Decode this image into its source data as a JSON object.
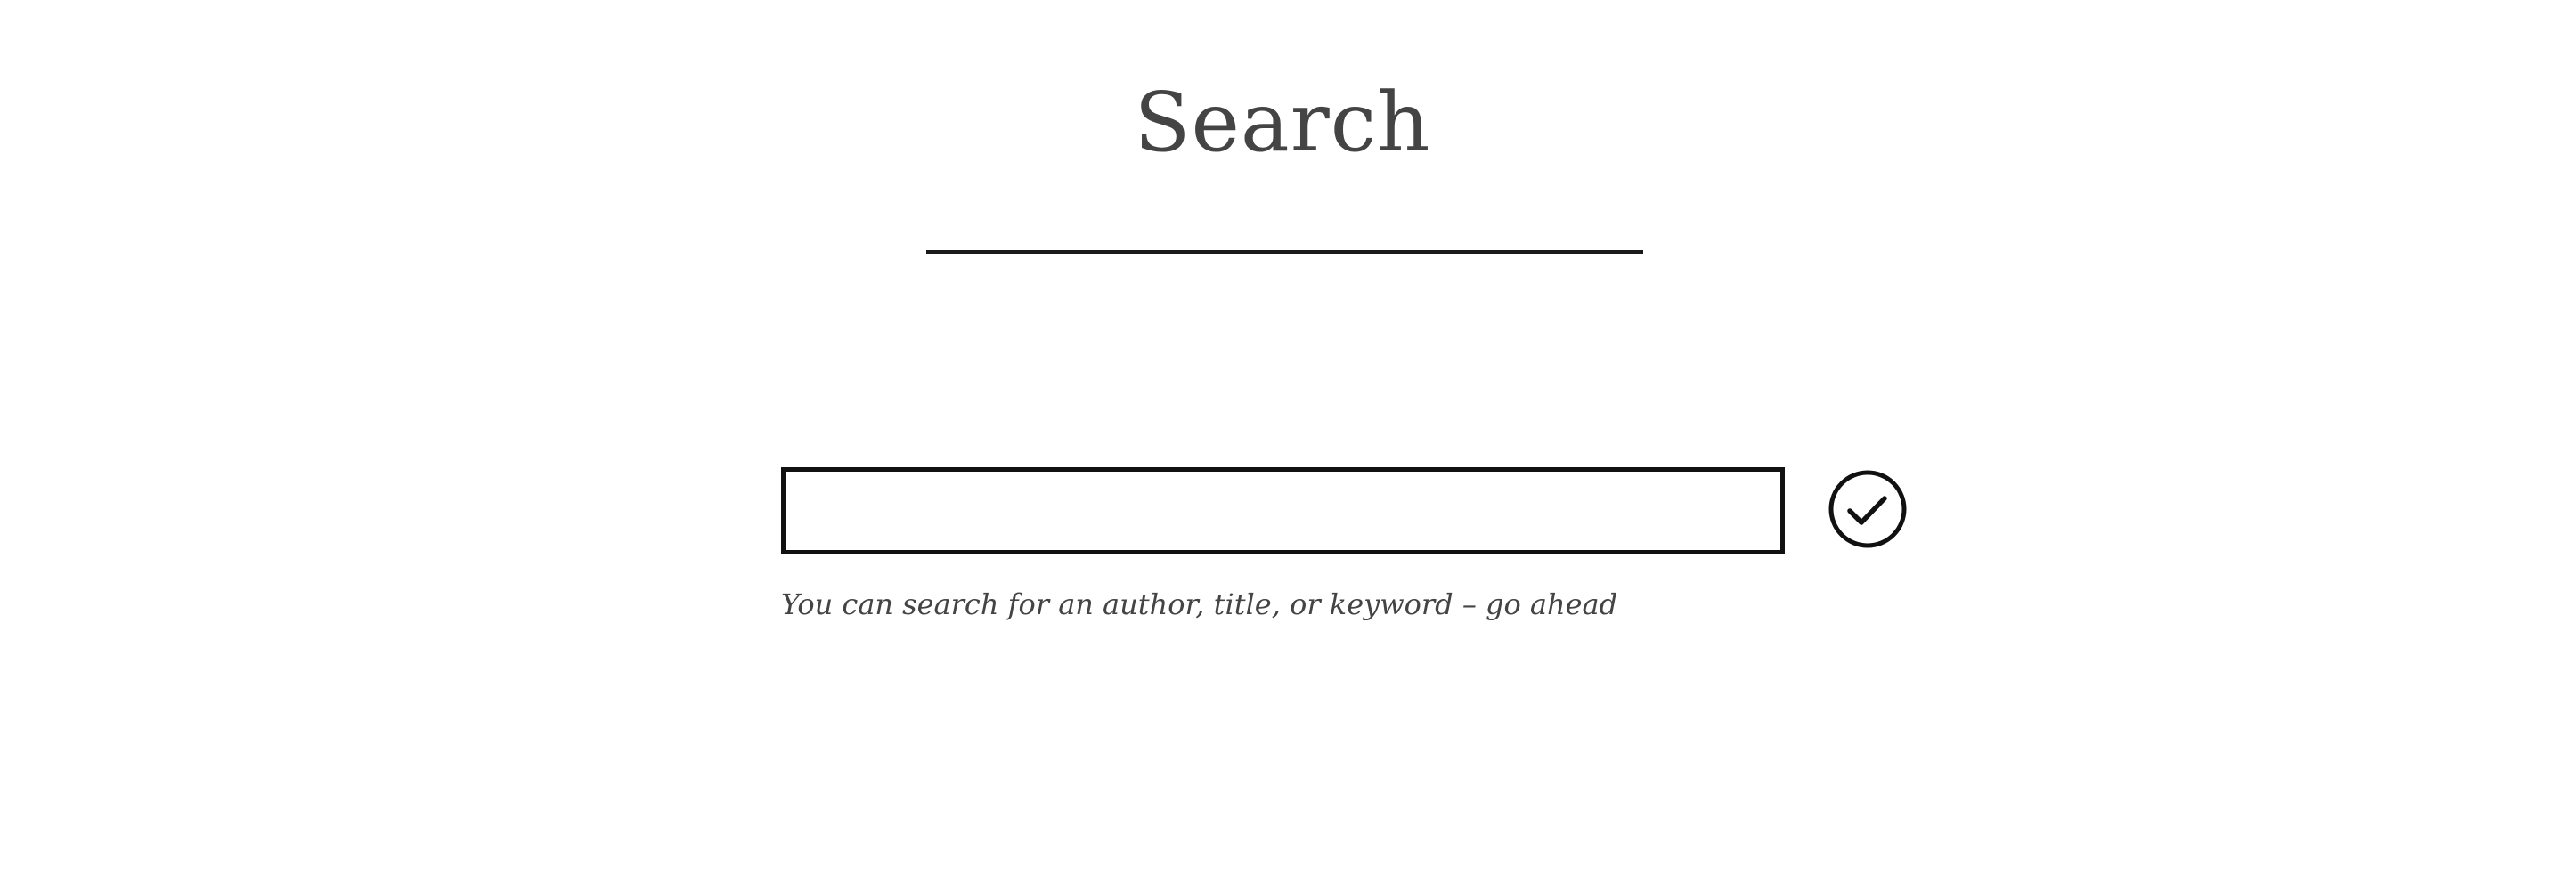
{
  "page": {
    "title": "Search"
  },
  "search": {
    "value": "",
    "placeholder": "",
    "help_text": "You can search for an author, title, or keyword – go ahead",
    "submit_icon": "check-circle-icon"
  },
  "colors": {
    "title_text": "#444444",
    "rule": "#1a1a1a",
    "input_border": "#111111",
    "icon_stroke": "#111111",
    "help_text": "#444444",
    "background": "#ffffff"
  }
}
